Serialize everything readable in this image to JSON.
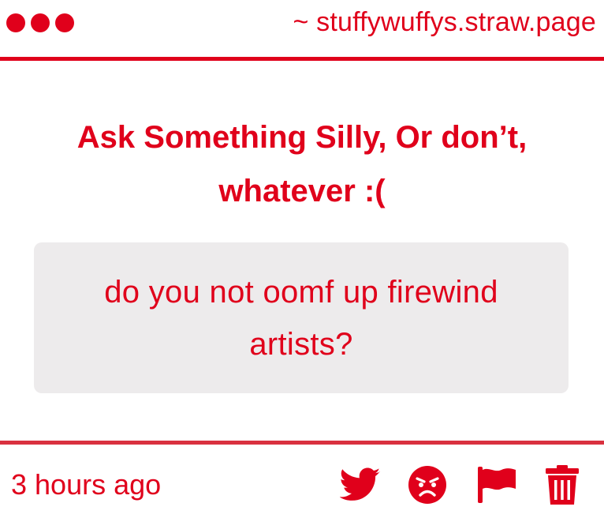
{
  "window": {
    "url": "~ stuffywuffys.straw.page",
    "dots": [
      "dot",
      "dot",
      "dot"
    ]
  },
  "question": {
    "title": "Ask Something Silly, Or don’t, whatever :(",
    "answer": "do you not oomf up firewind artists?"
  },
  "footer": {
    "timestamp": "3 hours ago",
    "actions": [
      {
        "icon": "twitter-icon"
      },
      {
        "icon": "angry-face-icon"
      },
      {
        "icon": "flag-icon"
      },
      {
        "icon": "trash-icon"
      }
    ]
  },
  "colors": {
    "accent": "#e0001b",
    "answer_background": "#edebec",
    "background": "#ffffff"
  }
}
